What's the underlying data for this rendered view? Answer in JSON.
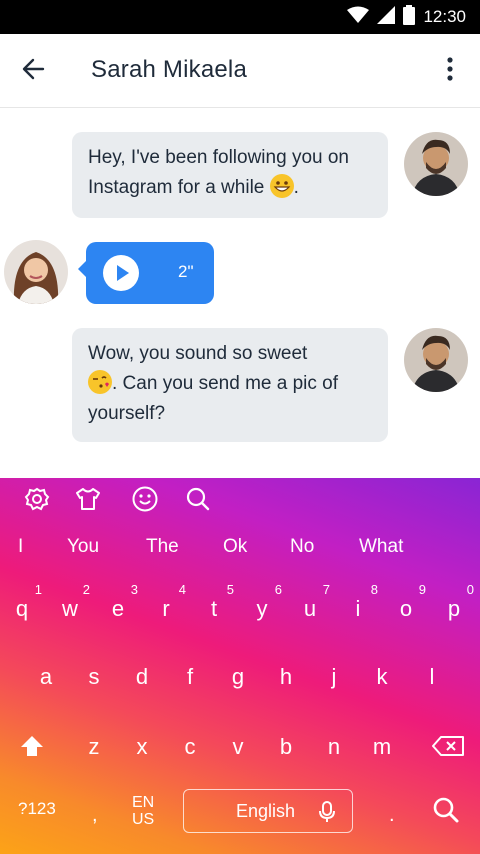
{
  "status_bar": {
    "time": "12:30",
    "icons": [
      "wifi-icon",
      "signal-icon",
      "battery-icon"
    ]
  },
  "header": {
    "contact_name": "Sarah Mikaela",
    "icons": [
      "back-arrow-icon",
      "more-vert-icon"
    ]
  },
  "messages": [
    {
      "from": "me",
      "text_before_emoji": "Hey, I've been following you on Instagram for a while ",
      "text_after_emoji": ".",
      "emoji": "grinning-face"
    },
    {
      "from": "contact",
      "type": "voice",
      "duration": "2\""
    },
    {
      "from": "me",
      "text_before_emoji": "Wow, you sound so sweet ",
      "text_after_emoji": ". Can you send me a pic of yourself?",
      "emoji": "face-blowing-kiss"
    }
  ],
  "keyboard": {
    "toolbar": [
      "settings-icon",
      "theme-shirt-icon",
      "emoji-icon",
      "search-icon"
    ],
    "suggestions": [
      "I",
      "You",
      "The",
      "Ok",
      "No",
      "What"
    ],
    "row1": [
      {
        "key": "q",
        "num": "1"
      },
      {
        "key": "w",
        "num": "2"
      },
      {
        "key": "e",
        "num": "3"
      },
      {
        "key": "r",
        "num": "4"
      },
      {
        "key": "t",
        "num": "5"
      },
      {
        "key": "y",
        "num": "6"
      },
      {
        "key": "u",
        "num": "7"
      },
      {
        "key": "i",
        "num": "8"
      },
      {
        "key": "o",
        "num": "9"
      },
      {
        "key": "p",
        "num": "0"
      }
    ],
    "row2": [
      "a",
      "s",
      "d",
      "f",
      "g",
      "h",
      "j",
      "k",
      "l"
    ],
    "row3": [
      "z",
      "x",
      "c",
      "v",
      "b",
      "n",
      "m"
    ],
    "bottom": {
      "symbols": "?123",
      "comma": ",",
      "lang_line1": "EN",
      "lang_line2": "US",
      "space_label": "English",
      "period": "."
    },
    "colors": {
      "gradient_top": "#8a25d4",
      "gradient_mid": "#ee1b7a",
      "gradient_bottom": "#fca317"
    }
  },
  "colors": {
    "voice_bubble": "#2d85f2",
    "text_bubble": "#e9ecef",
    "text": "#1f2b3a"
  }
}
